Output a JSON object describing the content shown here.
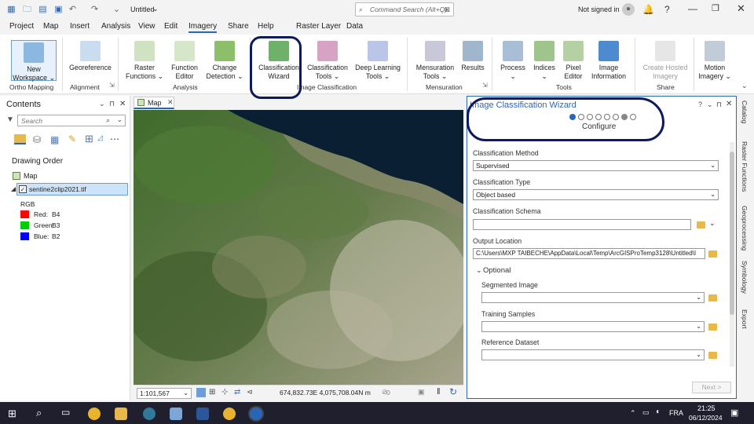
{
  "titlebar": {
    "doc_title": "Untitled",
    "search_placeholder": "Command Search (Alt+Q)",
    "signin": "Not signed in"
  },
  "menu": [
    "Project",
    "Map",
    "Insert",
    "Analysis",
    "View",
    "Edit",
    "Imagery",
    "Share",
    "Help",
    "Raster Layer",
    "Data"
  ],
  "ribbon": {
    "buttons": [
      {
        "label": "New\nWorkspace ⌄"
      },
      {
        "label": "Georeference"
      },
      {
        "label": "Raster\nFunctions ⌄"
      },
      {
        "label": "Function\nEditor"
      },
      {
        "label": "Change\nDetection ⌄"
      },
      {
        "label": "Classification\nWizard"
      },
      {
        "label": "Classification\nTools ⌄"
      },
      {
        "label": "Deep Learning\nTools ⌄"
      },
      {
        "label": "Mensuration\nTools ⌄"
      },
      {
        "label": "Results"
      },
      {
        "label": "Process\n⌄"
      },
      {
        "label": "Indices\n⌄"
      },
      {
        "label": "Pixel\nEditor"
      },
      {
        "label": "Image\nInformation"
      },
      {
        "label": "Create Hosted\nImagery"
      },
      {
        "label": "Motion\nImagery ⌄"
      }
    ],
    "groups": [
      "Ortho Mapping",
      "Alignment",
      "Analysis",
      "Image Classification",
      "Mensuration",
      "Tools",
      "Share"
    ]
  },
  "contents": {
    "title": "Contents",
    "search_placeholder": "Search",
    "drawing_order": "Drawing Order",
    "map_label": "Map",
    "layer": "sentine2clip2021.tif",
    "rgb": "RGB",
    "bands": [
      {
        "name": "Red:",
        "band": "B4",
        "color": "#ff0000"
      },
      {
        "name": "Green:",
        "band": "B3",
        "color": "#00cc00"
      },
      {
        "name": "Blue:",
        "band": "B2",
        "color": "#0000ff"
      }
    ]
  },
  "map": {
    "tab": "Map",
    "scale": "1:101,567",
    "coords": "674,832.73E 4,075,708.04N m",
    "sel_count": "0"
  },
  "wizard": {
    "title": "Image Classification Wizard",
    "step": "Configure",
    "method_label": "Classification Method",
    "method_value": "Supervised",
    "type_label": "Classification Type",
    "type_value": "Object based",
    "schema_label": "Classification Schema",
    "schema_value": "",
    "output_label": "Output Location",
    "output_value": "C:\\Users\\MXP TAIBECHE\\AppData\\Local\\Temp\\ArcGISProTemp3128\\Untitled\\I",
    "optional": "Optional",
    "segmented_label": "Segmented Image",
    "training_label": "Training Samples",
    "reference_label": "Reference Dataset",
    "next": "Next >"
  },
  "righttabs": [
    "Catalog",
    "Raster Functions",
    "Geoprocessing",
    "Symbology",
    "Export"
  ],
  "taskbar": {
    "lang": "FRA",
    "time": "21:25",
    "date": "06/12/2024"
  },
  "colors": {
    "accent": "#2a66b8",
    "annotation": "#0d1a5e"
  }
}
